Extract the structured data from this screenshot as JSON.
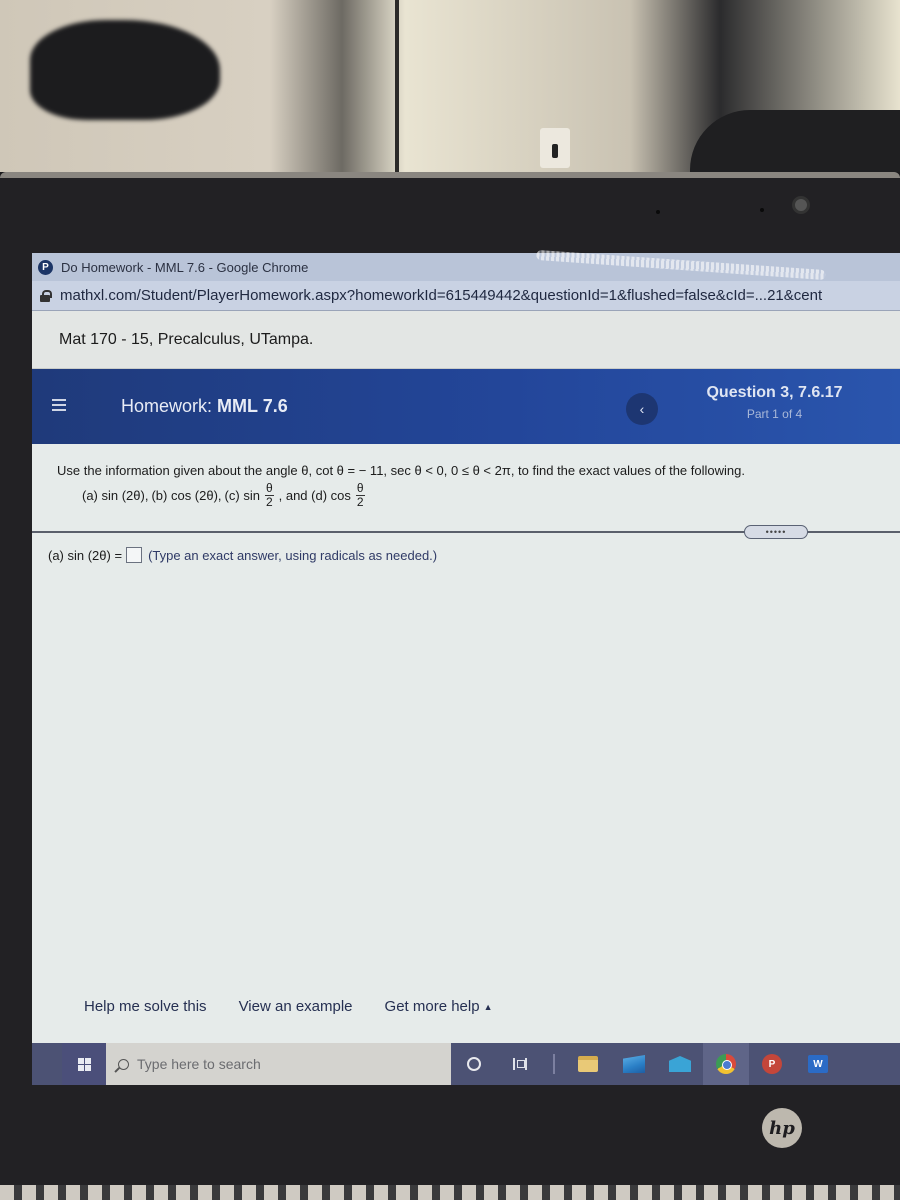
{
  "browser": {
    "window_title": "Do Homework - MML 7.6 - Google Chrome",
    "url": "mathxl.com/Student/PlayerHomework.aspx?homeworkId=615449442&questionId=1&flushed=false&cId=...21&cent"
  },
  "course": {
    "name": "Mat 170 - 15, Precalculus, UTampa."
  },
  "homework_header": {
    "prefix": "Homework:",
    "name": "MML 7.6",
    "question_title": "Question 3, 7.6.17",
    "question_part": "Part 1 of 4",
    "prev_icon": "chevron-left-icon"
  },
  "question": {
    "intro_text": "Use the information given about the angle θ, cot θ = − 11, sec θ < 0, 0 ≤ θ < 2π, to find the exact values of the following.",
    "parts_text": {
      "a": "(a) sin (2θ),",
      "b": "(b) cos (2θ),",
      "c": "(c) sin",
      "c_num": "θ",
      "c_den": "2",
      "sep": ", and (d) cos",
      "d_num": "θ",
      "d_den": "2"
    },
    "expand_handle": "•••••"
  },
  "answer": {
    "label": "(a) sin (2θ) =",
    "value": "",
    "hint": "(Type an exact answer, using radicals as needed.)"
  },
  "help_links": {
    "help_solve": "Help me solve this",
    "view_example": "View an example",
    "more_help": "Get more help",
    "more_help_caret": "▲"
  },
  "taskbar": {
    "search_placeholder": "Type here to search",
    "apps": [
      "cortana",
      "task-view",
      "file-explorer",
      "photos",
      "mail",
      "chrome",
      "powerpoint",
      "word"
    ],
    "ppt_letter": "P",
    "word_letter": "W"
  },
  "device": {
    "brand": "hp"
  }
}
